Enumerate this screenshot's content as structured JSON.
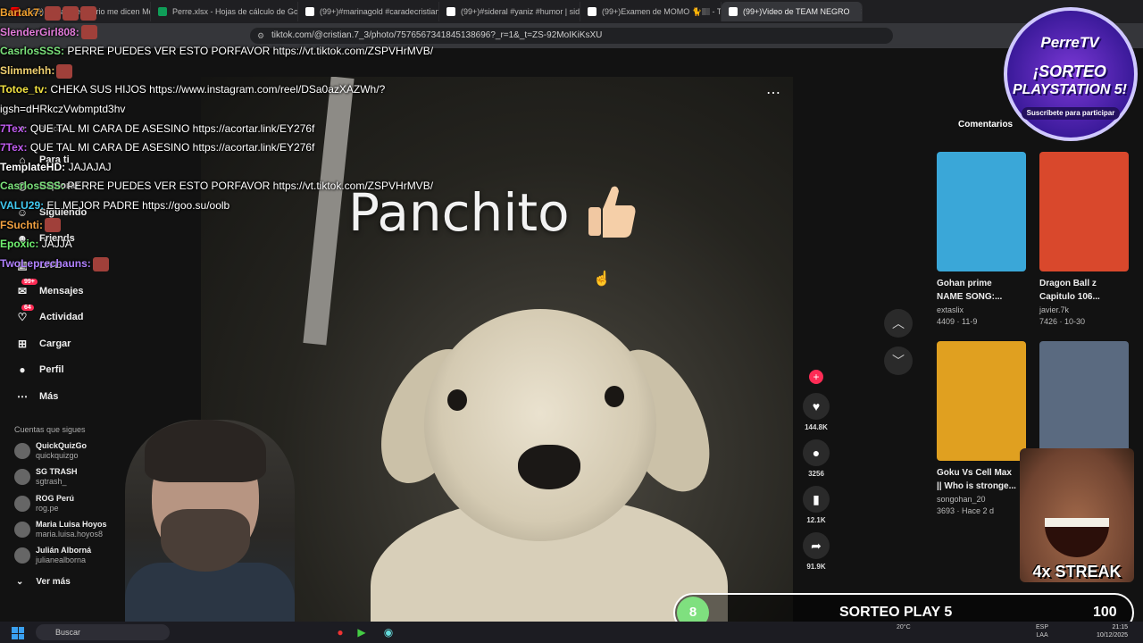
{
  "browser": {
    "tabs": [
      {
        "label": "(128) yo salí del barrio me dicen Mo",
        "color": "#ff0000"
      },
      {
        "label": "Perre.xlsx - Hojas de cálculo de Goo",
        "color": "#0f9d58"
      },
      {
        "label": "(99+)#marinagold #caradecristian #",
        "color": "#ffffff"
      },
      {
        "label": "(99+)#sideral #yaniz #humor | sider",
        "color": "#ffffff"
      },
      {
        "label": "(99+)Examen de MOMO 🐈🏽 - T",
        "color": "#ffffff"
      },
      {
        "label": "(99+)Video de TEAM NEGRO",
        "color": "#ffffff",
        "active": true
      }
    ],
    "url": "tiktok.com/@cristian.7_3/photo/7576567341845138696?_r=1&_t=ZS-92MoIKiKsXU"
  },
  "sidebar": {
    "search_placeholder": "Buscar",
    "items": [
      {
        "icon": "home-icon",
        "label": "Para ti"
      },
      {
        "icon": "compass-icon",
        "label": "Explorar"
      },
      {
        "icon": "following-icon",
        "label": "Siguiendo"
      },
      {
        "icon": "friends-icon",
        "label": "Friends"
      },
      {
        "icon": "live-icon",
        "label": "LIVE"
      },
      {
        "icon": "messages-icon",
        "label": "Mensajes",
        "badge": "99+"
      },
      {
        "icon": "activity-icon",
        "label": "Actividad",
        "badge": "64"
      },
      {
        "icon": "upload-icon",
        "label": "Cargar"
      },
      {
        "icon": "profile-icon",
        "label": "Perfil"
      },
      {
        "icon": "more-icon",
        "label": "Más"
      }
    ],
    "following_title": "Cuentas que sigues",
    "following": [
      {
        "name": "QuickQuizGo",
        "handle": "quickquizgo"
      },
      {
        "name": "SG TRASH",
        "handle": "sgtrash_"
      },
      {
        "name": "ROG Perú",
        "handle": "rog.pe"
      },
      {
        "name": "Maria Luisa Hoyos",
        "handle": "maria.luisa.hoyos8"
      },
      {
        "name": "Julián Alborná",
        "handle": "julianealborna"
      }
    ],
    "see_more": "Ver más"
  },
  "video": {
    "caption": "Panchito",
    "likes": "144.8K",
    "comments": "3256",
    "saves": "12.1K",
    "shares": "91.9K"
  },
  "right_panel": {
    "tab": "Comentarios",
    "cards": [
      {
        "title1": "Gohan prime",
        "title2": "NAME SONG:...",
        "author": "extaslix",
        "stats": "4409 · 11-9",
        "color": "#3aa7d8"
      },
      {
        "title1": "Dragon Ball z",
        "title2": "Capitulo 106...",
        "author": "javier.7k",
        "stats": "7426 · 10-30",
        "color": "#d9482c"
      },
      {
        "title1": "Goku Vs Cell Max",
        "title2": "|| Who is stronge...",
        "author": "songohan_20",
        "stats": "3693 · Hace 2 d",
        "color": "#e0a020"
      },
      {
        "title1": "",
        "title2": "",
        "author": "",
        "stats": "",
        "color": "#5a6a80"
      }
    ]
  },
  "chat": [
    {
      "user": "Bartak7:",
      "color": "#f0a030",
      "text": "",
      "emotes": 3
    },
    {
      "user": "SlenderGirl808:",
      "color": "#e07ad8",
      "text": "",
      "emotes": 1
    },
    {
      "user": "CasrlosSSS:",
      "color": "#7ae07a",
      "text": "PERRE PUEDES VER ESTO PORFAVOR https://vt.tiktok.com/ZSPVHrMVB/",
      "emotes": 0
    },
    {
      "user": "Slimmehh:",
      "color": "#f0d070",
      "text": "",
      "emotes": 1
    },
    {
      "user": "Totoe_tv:",
      "color": "#f0e040",
      "text": "CHEKA SUS HIJOS https://www.instagram.com/reel/DSa0azXAZWh/?",
      "emotes": 0
    },
    {
      "user": "",
      "color": "#ffffff",
      "text": "igsh=dHRkczVwbmptd3hv",
      "emotes": 0
    },
    {
      "user": "7Tex:",
      "color": "#c05cf0",
      "text": "QUE TAL MI CARA DE ASESINO https://acortar.link/EY276f",
      "emotes": 0
    },
    {
      "user": "7Tex:",
      "color": "#c05cf0",
      "text": "QUE TAL MI CARA DE ASESINO https://acortar.link/EY276f",
      "emotes": 0
    },
    {
      "user": "TemplateHD:",
      "color": "#ffffff",
      "text": "JAJAJAJ",
      "emotes": 0
    },
    {
      "user": "CasrlosSSS:",
      "color": "#7ae07a",
      "text": "PERRE PUEDES VER ESTO PORFAVOR https://vt.tiktok.com/ZSPVHrMVB/",
      "emotes": 0
    },
    {
      "user": "VALU29:",
      "color": "#40c8f0",
      "text": "EL MEJOR PADRE https://goo.su/oolb",
      "emotes": 0
    },
    {
      "user": "FSuchti:",
      "color": "#f0a040",
      "text": "",
      "emotes": 1
    },
    {
      "user": "Epoxic:",
      "color": "#70f070",
      "text": "JAJJA",
      "emotes": 0
    },
    {
      "user": "TwoLeprechauns:",
      "color": "#b080ff",
      "text": "",
      "emotes": 1
    }
  ],
  "overlay": {
    "brand": "PerreTV",
    "promo_line1": "¡SORTEO",
    "promo_line2": "PLAYSTATION 5!",
    "promo_sub": "Suscríbete para participar",
    "streak": "4x STREAK",
    "giveaway_count": "8",
    "giveaway_label": "SORTEO PLAY 5",
    "giveaway_total": "100"
  },
  "taskbar": {
    "search": "Buscar",
    "weather": "20°C",
    "lang1": "ESP",
    "lang2": "LAA",
    "time": "21:15",
    "date": "10/12/2025"
  }
}
